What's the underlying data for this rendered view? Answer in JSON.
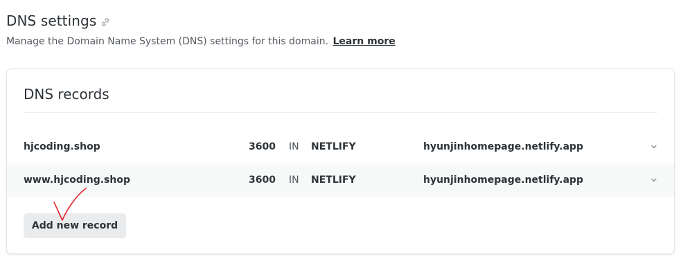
{
  "header": {
    "title": "DNS settings",
    "subtitle": "Manage the Domain Name System (DNS) settings for this domain.",
    "learn_more": "Learn more"
  },
  "card": {
    "title": "DNS records",
    "records": [
      {
        "name": "hjcoding.shop",
        "ttl": "3600",
        "class": "IN",
        "type": "NETLIFY",
        "value": "hyunjinhomepage.netlify.app"
      },
      {
        "name": "www.hjcoding.shop",
        "ttl": "3600",
        "class": "IN",
        "type": "NETLIFY",
        "value": "hyunjinhomepage.netlify.app"
      }
    ],
    "add_button": "Add new record"
  },
  "colors": {
    "text": "#2e3338",
    "muted": "#545a61",
    "alt_row": "#f7f8f8",
    "button_bg": "#e9ebed",
    "annotation": "#e3262f"
  },
  "icons": {
    "title_link": "link-icon",
    "row_expand": "chevron-down-icon"
  }
}
